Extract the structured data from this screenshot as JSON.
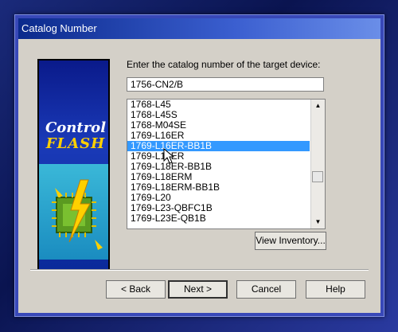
{
  "window": {
    "title": "Catalog Number"
  },
  "banner": {
    "logo_line1": "Control",
    "logo_line2": "FLASH"
  },
  "prompt": "Enter the catalog number of the target device:",
  "catalog_input": {
    "value": "1756-CN2/B"
  },
  "catalog_list": {
    "items": [
      "1768-L45",
      "1768-L45S",
      "1768-M04SE",
      "1769-L16ER",
      "1769-L16ER-BB1B",
      "1769-L18ER",
      "1769-L18ER-BB1B",
      "1769-L18ERM",
      "1769-L18ERM-BB1B",
      "1769-L20",
      "1769-L23-QBFC1B",
      "1769-L23E-QB1B"
    ],
    "selected_index": 4
  },
  "buttons": {
    "view_inventory": "View Inventory...",
    "back": "< Back",
    "next": "Next >",
    "cancel": "Cancel",
    "help": "Help"
  },
  "colors": {
    "selection": "#3399ff",
    "title_bar": "#0b2a8c"
  }
}
